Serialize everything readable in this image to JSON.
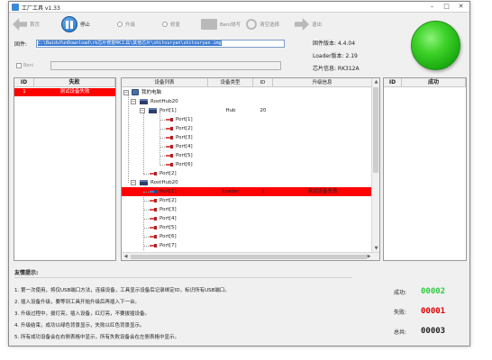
{
  "window": {
    "title": "工厂工具 v1.33"
  },
  "toolbar": {
    "back_label": "首页",
    "pause_label": "停止",
    "upgrade_label": "升级",
    "repair_label": "修复",
    "flash_label": "Beni烧写",
    "clear_label": "清空选择",
    "exit_label": "退出"
  },
  "firmware": {
    "label": "固件:",
    "path": "C:\\BaiduYunDownload\\rk芯片修复RK工具\\其他芯片\\shitouryan\\shitouryan.img"
  },
  "info": {
    "firmware_version": "固件版本: 4.4.04",
    "loader_version": "Loader版本: 2.19",
    "chip_info": "芯片信息: RK312A"
  },
  "burn": {
    "label": "Beni"
  },
  "fail_panel": {
    "col_id": "ID",
    "col_fail": "失败",
    "rows": [
      {
        "id": "1",
        "text": "测试设备失败"
      }
    ]
  },
  "tree": {
    "headers": [
      "设备列表",
      "设备类型",
      "ID",
      "升级信息"
    ],
    "root_label": "我的电脑",
    "hub1_label": "RootHub20",
    "hub1_port1": {
      "label": "Port[1]",
      "type": "Hub",
      "id": "20"
    },
    "hub1_children": [
      "Port[1]",
      "Port[2]",
      "Port[3]",
      "Port[4]",
      "Port[5]",
      "Port[6]"
    ],
    "hub1_port2": "Port[2]",
    "hub2_label": "RootHub20",
    "hub2_selected": {
      "label": "Port[1]",
      "type": "Loader",
      "id": "1",
      "info": "测试设备失败"
    },
    "hub2_ports": [
      "Port[2]",
      "Port[3]",
      "Port[4]",
      "Port[5]",
      "Port[6]",
      "Port[7]"
    ]
  },
  "success_panel": {
    "col_id": "ID",
    "col_success": "成功"
  },
  "tips": {
    "title": "友情提示:",
    "lines": [
      "1. 第一次使用，将仅USB端口方法，连接设备，工具显示设备后记录绑定ID，标识所有USB端口。",
      "2. 插入设备升级，要等到工具开始升级后再插入下一台。",
      "3. 升级过程中，拔灯亮，插入设备，红灯亮，不要拔插设备。",
      "4. 升级结束，成功以绿色背景显示，失败以红色背景显示。",
      "5. 所有成功设备会在右侧表格中显示，所有失败设备会在左侧表格中显示。"
    ]
  },
  "stats": {
    "success_label": "成功:",
    "success_value": "00002",
    "fail_label": "失败:",
    "fail_value": "00001",
    "total_label": "总共:",
    "total_value": "00003",
    "colors": {
      "success": "#2ecc40",
      "fail": "#e00000",
      "total": "#222222"
    }
  }
}
